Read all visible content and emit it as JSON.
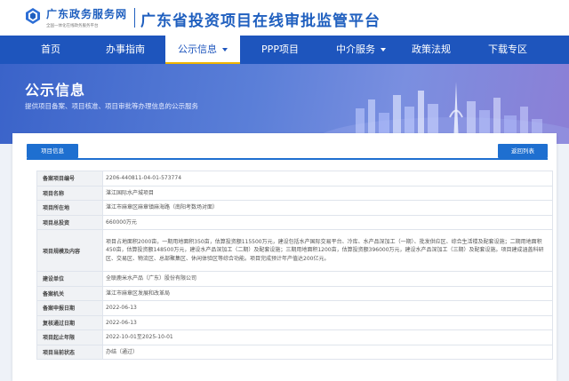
{
  "header": {
    "brand_name": "广东政务服务网",
    "brand_slogan": "全国一体化在线政务服务平台",
    "site_title": "广东省投资项目在线审批监管平台"
  },
  "nav": {
    "items": [
      {
        "label": "首页",
        "has_dropdown": false,
        "active": false
      },
      {
        "label": "办事指南",
        "has_dropdown": false,
        "active": false
      },
      {
        "label": "公示信息",
        "has_dropdown": true,
        "active": true
      },
      {
        "label": "PPP项目",
        "has_dropdown": false,
        "active": false
      },
      {
        "label": "中介服务",
        "has_dropdown": true,
        "active": false
      },
      {
        "label": "政策法规",
        "has_dropdown": false,
        "active": false
      },
      {
        "label": "下载专区",
        "has_dropdown": false,
        "active": false
      }
    ]
  },
  "banner": {
    "title": "公示信息",
    "subtitle": "提供项目备案、项目核准、项目审批等办理信息的公示服务"
  },
  "panel": {
    "tab_label": "项目信息",
    "back_button": "返回列表"
  },
  "rows": [
    {
      "label": "备案项目编号",
      "value": "2206-440811-04-01-573774"
    },
    {
      "label": "项目名称",
      "value": "湛江国际水产城项目"
    },
    {
      "label": "项目所在地",
      "value": "湛江市麻章区麻章镇麻海路（南阳考数场对面）"
    },
    {
      "label": "项目总投资",
      "value": "660000万元"
    },
    {
      "label": "项目规模及内容",
      "value": "项目占地面积2000亩，一期用地面积350亩，估算投资额115500万元，建设包括水产国际交易平台、冷库、水产品深加工（一期）、批发供应区、综合生活楼及配套设施；二期用地面积450亩，估算投资额148500万元，建设水产品深加工（二期）及配套设施；三期用地面积1200亩，估算投资额396000万元，建设水产品深加工（三期）及配套设施。项目建成涵盖科研区、交易区、物流区、总部聚集区、休闲体验区等综合功能。项目完成预计年产值达200亿元。"
    },
    {
      "label": "建设单位",
      "value": "全联鹿米水产品（广东）股份有限公司"
    },
    {
      "label": "备案机关",
      "value": "湛江市麻章区发展和改革局"
    },
    {
      "label": "备案申报日期",
      "value": "2022-06-13"
    },
    {
      "label": "复核通过日期",
      "value": "2022-06-13"
    },
    {
      "label": "项目起止年限",
      "value": "2022-10-01至2025-10-01"
    },
    {
      "label": "项目当前状态",
      "value": "办结（通过）"
    }
  ],
  "colors": {
    "primary": "#1e55bd",
    "accent": "#1e6fd0",
    "active_underline": "#f0b400"
  }
}
